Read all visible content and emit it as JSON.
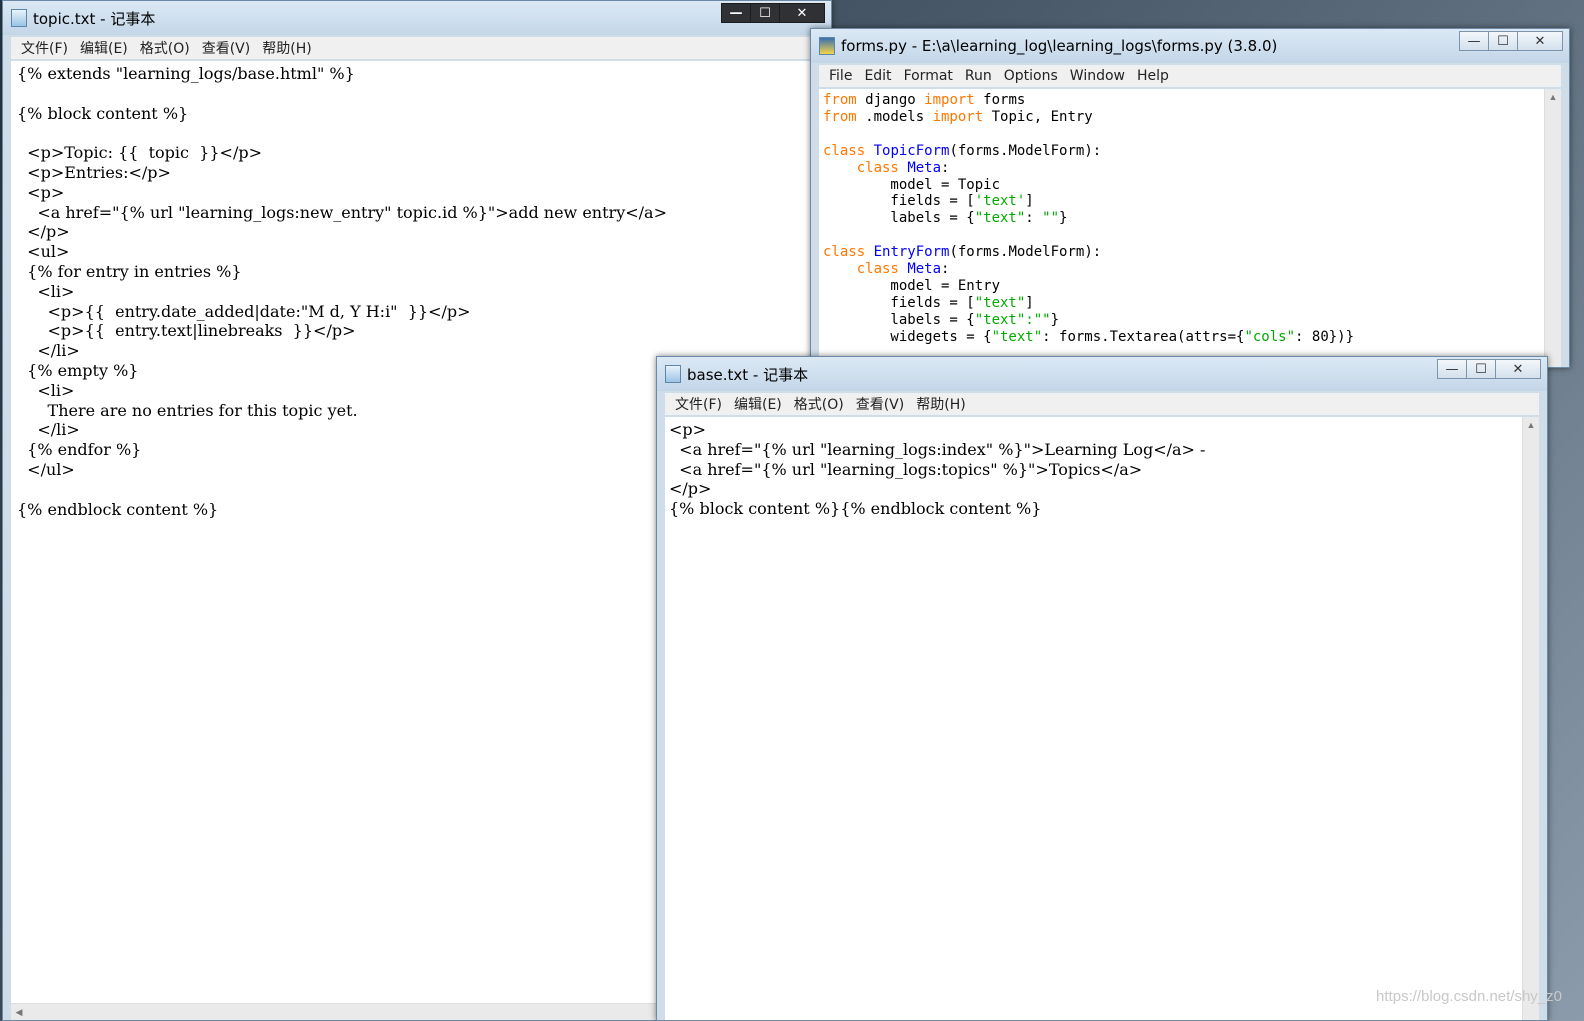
{
  "topic_window": {
    "title": "topic.txt - 记事本",
    "menu": [
      "文件(F)",
      "编辑(E)",
      "格式(O)",
      "查看(V)",
      "帮助(H)"
    ],
    "lines": [
      "{% extends \"learning_logs/base.html\" %}",
      "",
      "{% block content %}",
      "",
      "  <p>Topic: {{  topic  }}</p>",
      "  <p>Entries:</p>",
      "  <p>",
      "    <a href=\"{% url \"learning_logs:new_entry\" topic.id %}\">add new entry</a>",
      "  </p>",
      "  <ul>",
      "  {% for entry in entries %}",
      "    <li>",
      "      <p>{{  entry.date_added|date:\"M d, Y H:i\"  }}</p>",
      "      <p>{{  entry.text|linebreaks  }}</p>",
      "    </li>",
      "  {% empty %}",
      "    <li>",
      "      There are no entries for this topic yet.",
      "    </li>",
      "  {% endfor %}",
      "  </ul>",
      "",
      "{% endblock content %}"
    ]
  },
  "forms_window": {
    "title": "forms.py - E:\\a\\learning_log\\learning_logs\\forms.py (3.8.0)",
    "menu": [
      "File",
      "Edit",
      "Format",
      "Run",
      "Options",
      "Window",
      "Help"
    ],
    "code": [
      [
        [
          "kw",
          "from"
        ],
        [
          "t",
          " django "
        ],
        [
          "kw",
          "import"
        ],
        [
          "t",
          " forms"
        ]
      ],
      [
        [
          "kw",
          "from"
        ],
        [
          "t",
          " .models "
        ],
        [
          "kw",
          "import"
        ],
        [
          "t",
          " Topic, Entry"
        ]
      ],
      [],
      [
        [
          "kw",
          "class"
        ],
        [
          "t",
          " "
        ],
        [
          "def",
          "TopicForm"
        ],
        [
          "t",
          "(forms.ModelForm):"
        ]
      ],
      [
        [
          "t",
          "    "
        ],
        [
          "kw",
          "class"
        ],
        [
          "t",
          " "
        ],
        [
          "def",
          "Meta"
        ],
        [
          "t",
          ":"
        ]
      ],
      [
        [
          "t",
          "        model = Topic"
        ]
      ],
      [
        [
          "t",
          "        fields = ["
        ],
        [
          "str",
          "'text'"
        ],
        [
          "t",
          "]"
        ]
      ],
      [
        [
          "t",
          "        labels = {"
        ],
        [
          "str",
          "\"text\""
        ],
        [
          "t",
          ": "
        ],
        [
          "str",
          "\"\""
        ],
        [
          "t",
          "}"
        ]
      ],
      [],
      [
        [
          "kw",
          "class"
        ],
        [
          "t",
          " "
        ],
        [
          "def",
          "EntryForm"
        ],
        [
          "t",
          "(forms.ModelForm):"
        ]
      ],
      [
        [
          "t",
          "    "
        ],
        [
          "kw",
          "class"
        ],
        [
          "t",
          " "
        ],
        [
          "def",
          "Meta"
        ],
        [
          "t",
          ":"
        ]
      ],
      [
        [
          "t",
          "        model = Entry"
        ]
      ],
      [
        [
          "t",
          "        fields = ["
        ],
        [
          "str",
          "\"text\""
        ],
        [
          "t",
          "]"
        ]
      ],
      [
        [
          "t",
          "        labels = {"
        ],
        [
          "str",
          "\"text\":\"\""
        ],
        [
          "t",
          "}"
        ]
      ],
      [
        [
          "t",
          "        widegets = {"
        ],
        [
          "str",
          "\"text\""
        ],
        [
          "t",
          ": forms.Textarea(attrs={"
        ],
        [
          "str",
          "\"cols\""
        ],
        [
          "t",
          ": 80})}"
        ]
      ]
    ]
  },
  "base_window": {
    "title": "base.txt - 记事本",
    "menu": [
      "文件(F)",
      "编辑(E)",
      "格式(O)",
      "查看(V)",
      "帮助(H)"
    ],
    "lines": [
      "<p>",
      "  <a href=\"{% url \"learning_logs:index\" %}\">Learning Log</a> -",
      "  <a href=\"{% url \"learning_logs:topics\" %}\">Topics</a>",
      "</p>",
      "{% block content %}{% endblock content %}"
    ]
  },
  "controls": {
    "minimize": "—",
    "maximize": "☐",
    "close": "✕"
  },
  "watermark": "https://blog.csdn.net/shy_z0"
}
